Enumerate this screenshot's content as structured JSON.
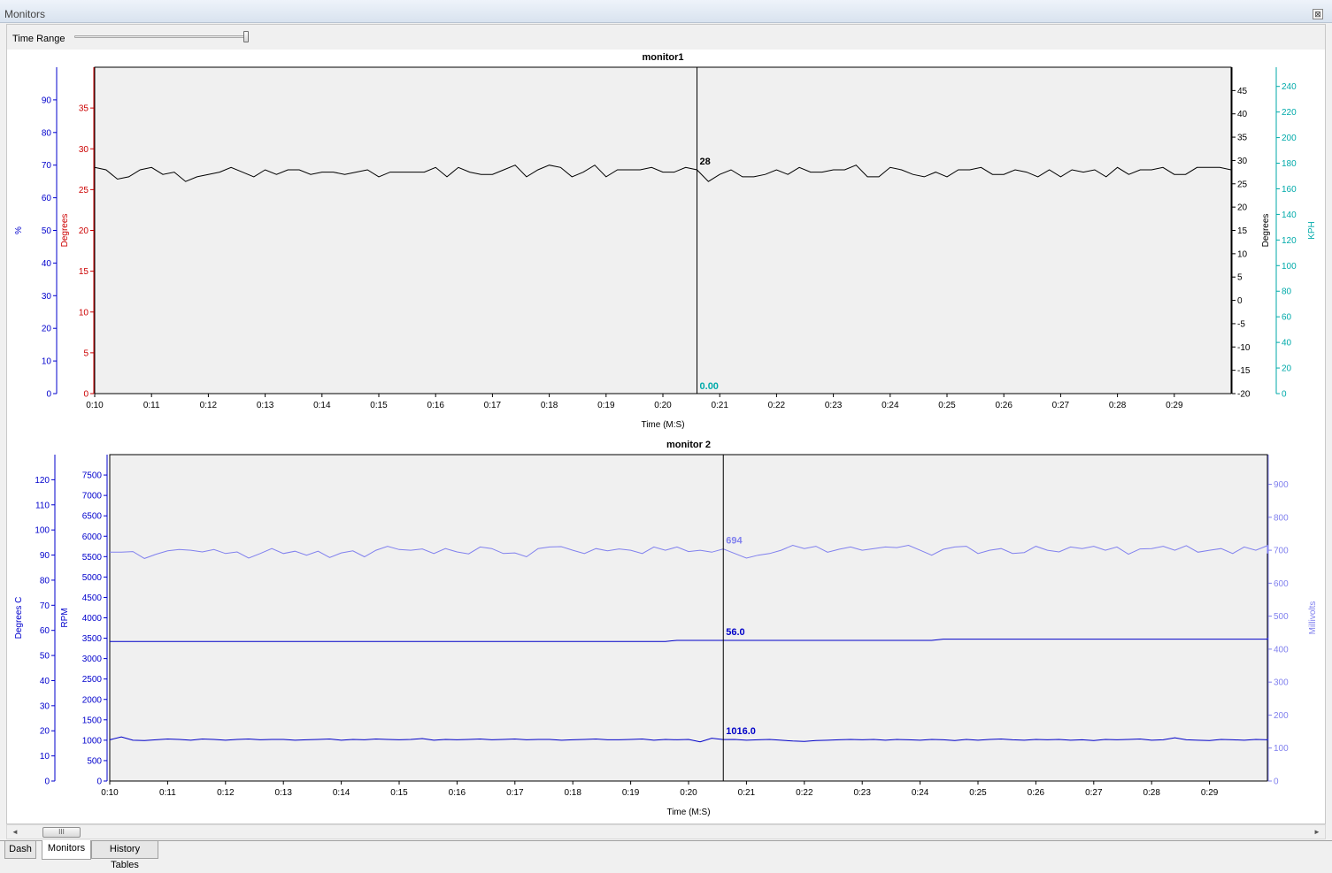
{
  "window": {
    "title": "Monitors",
    "close_glyph": "⊠"
  },
  "toolbar": {
    "time_range_label": "Time Range",
    "time_range_value": 1.0
  },
  "scrollbar": {
    "left_arrow": "◄",
    "right_arrow": "►",
    "thumb_grip": "III"
  },
  "tabs": [
    {
      "label": "Dash",
      "active": false
    },
    {
      "label": "Monitors",
      "active": true
    },
    {
      "label": "History Tables",
      "active": false
    }
  ],
  "colors": {
    "plot_bg": "#f0f0f0",
    "blue_axis": "#0000cc",
    "red_axis": "#cc0000",
    "black": "#000000",
    "cyan": "#00aaaa",
    "lavender": "#8080ee",
    "navy": "#0000c8"
  },
  "x_ticks": [
    "0:10",
    "0:11",
    "0:12",
    "0:13",
    "0:14",
    "0:15",
    "0:16",
    "0:17",
    "0:18",
    "0:19",
    "0:20",
    "0:21",
    "0:22",
    "0:23",
    "0:24",
    "0:25",
    "0:26",
    "0:27",
    "0:28",
    "0:29"
  ],
  "chart_data": [
    {
      "type": "line",
      "title": "monitor1",
      "xlabel": "Time (M:S)",
      "xlim": [
        "0:10",
        "0:30"
      ],
      "cursor": {
        "x": "0:20.6",
        "labels": [
          "28",
          "0.00"
        ]
      },
      "axes": [
        {
          "side": "left",
          "label": "%",
          "ticks": [
            0,
            10,
            20,
            30,
            40,
            50,
            60,
            70,
            80,
            90
          ],
          "range": [
            0,
            100
          ]
        },
        {
          "side": "left",
          "label": "Degrees",
          "ticks": [
            0,
            5,
            10,
            15,
            20,
            25,
            30,
            35
          ],
          "range": [
            0,
            40
          ]
        },
        {
          "side": "right",
          "label": "Degrees",
          "ticks": [
            -20,
            -15,
            -10,
            -5,
            0,
            5,
            10,
            15,
            20,
            25,
            30,
            35,
            40,
            45
          ],
          "range": [
            -20,
            50
          ]
        },
        {
          "side": "right",
          "label": "KPH",
          "ticks": [
            0,
            20,
            40,
            60,
            80,
            100,
            120,
            140,
            160,
            180,
            200,
            220,
            240
          ],
          "range": [
            0,
            255
          ]
        }
      ],
      "series": [
        {
          "axis": 2,
          "x_start": 10.0,
          "x_step": 0.2,
          "values": [
            28.5,
            28,
            26,
            26.5,
            28,
            28.5,
            27,
            27.5,
            25.5,
            26.5,
            27,
            27.5,
            28.5,
            27.5,
            26.5,
            28,
            27,
            28,
            28,
            27,
            27.5,
            27.5,
            27,
            27.5,
            28,
            26.5,
            27.5,
            27.5,
            27.5,
            27.5,
            28.5,
            26.5,
            28.5,
            27.5,
            27,
            27,
            28,
            29,
            26.5,
            28,
            29,
            28.5,
            26.5,
            27.5,
            29,
            26.5,
            28,
            28,
            28,
            28.5,
            27.5,
            27.5,
            28.5,
            28,
            25.5,
            27,
            28,
            26.5,
            26.5,
            27,
            28,
            27,
            28.5,
            27.5,
            27.5,
            28,
            28,
            29,
            26.5,
            26.5,
            28.5,
            28,
            27,
            26.5,
            27.5,
            26.5,
            28,
            28,
            28.5,
            27,
            27,
            28,
            27.5,
            26.5,
            28,
            26.5,
            28,
            27.5,
            28,
            26.5,
            28.5,
            27,
            28,
            28,
            28.5,
            27,
            27,
            28.5,
            28.5,
            28.5,
            28,
            26,
            25.5,
            27,
            25,
            27,
            25.5,
            27,
            28.5,
            28,
            27.5,
            27.5,
            27.5,
            28,
            27,
            28,
            28,
            28
          ]
        }
      ]
    },
    {
      "type": "line",
      "title": "monitor 2",
      "xlabel": "Time (M:S)",
      "xlim": [
        "0:10",
        "0:30"
      ],
      "cursor": {
        "x": "0:20.6",
        "labels": [
          "694",
          "56.0",
          "1016.0"
        ]
      },
      "axes": [
        {
          "side": "left",
          "label": "Degrees C",
          "ticks": [
            0,
            10,
            20,
            30,
            40,
            50,
            60,
            70,
            80,
            90,
            100,
            110,
            120
          ],
          "range": [
            0,
            130
          ]
        },
        {
          "side": "left",
          "label": "RPM",
          "ticks": [
            0,
            500,
            1000,
            1500,
            2000,
            2500,
            3000,
            3500,
            4000,
            4500,
            5000,
            5500,
            6000,
            6500,
            7000,
            7500
          ],
          "range": [
            0,
            8000
          ]
        },
        {
          "side": "right",
          "label": "Millivolts",
          "ticks": [
            0,
            100,
            200,
            300,
            400,
            500,
            600,
            700,
            800,
            900
          ],
          "range": [
            0,
            990
          ]
        }
      ],
      "series": [
        {
          "axis": 2,
          "x_start": 10.0,
          "x_step": 0.2,
          "values": [
            694,
            694,
            696,
            675,
            688,
            698,
            702,
            700,
            695,
            702,
            690,
            695,
            676,
            690,
            705,
            690,
            697,
            685,
            697,
            678,
            692,
            698,
            680,
            700,
            712,
            702,
            700,
            704,
            690,
            705,
            695,
            689,
            710,
            705,
            690,
            692,
            680,
            705,
            710,
            711,
            700,
            690,
            705,
            698,
            704,
            700,
            690,
            710,
            700,
            710,
            696,
            700,
            694,
            704,
            690,
            676,
            685,
            690,
            700,
            715,
            705,
            712,
            694,
            703,
            710,
            700,
            705,
            710,
            708,
            715,
            700,
            685,
            703,
            710,
            712,
            690,
            700,
            705,
            690,
            693,
            712,
            700,
            695,
            710,
            705,
            712,
            700,
            710,
            688,
            704,
            705,
            712,
            700,
            714,
            694,
            700,
            705,
            690,
            710,
            700,
            714,
            712,
            700,
            712,
            695,
            690,
            714,
            712,
            700,
            712,
            695,
            700,
            704,
            714,
            712,
            700,
            712,
            690,
            700,
            705
          ]
        },
        {
          "axis": 0,
          "x_start": 10.0,
          "x_step": 0.2,
          "values": [
            55.6,
            55.6,
            55.6,
            55.6,
            55.6,
            55.6,
            55.6,
            55.6,
            55.6,
            55.6,
            55.6,
            55.6,
            55.6,
            55.6,
            55.6,
            55.6,
            55.6,
            55.6,
            55.6,
            55.6,
            55.6,
            55.6,
            55.6,
            55.6,
            55.6,
            55.6,
            55.6,
            55.6,
            55.6,
            55.6,
            55.6,
            55.6,
            55.6,
            55.6,
            55.6,
            55.6,
            55.6,
            55.6,
            55.6,
            55.6,
            55.6,
            55.6,
            55.6,
            55.6,
            55.6,
            55.6,
            55.6,
            55.6,
            55.6,
            56.0,
            56.0,
            56.0,
            56.0,
            56.0,
            56.0,
            56.0,
            56.0,
            56.0,
            56.0,
            56.0,
            56.0,
            56.0,
            56.0,
            56.0,
            56.0,
            56.0,
            56.0,
            56.0,
            56.0,
            56.0,
            56.0,
            56.0,
            56.5,
            56.5,
            56.5,
            56.5,
            56.5,
            56.5,
            56.5,
            56.5,
            56.5,
            56.5,
            56.5,
            56.5,
            56.5,
            56.5,
            56.5,
            56.5,
            56.5,
            56.5,
            56.5,
            56.5,
            56.5,
            56.5,
            56.5,
            56.5,
            56.5,
            56.5,
            56.5,
            56.5,
            56.5,
            56.5,
            56.5,
            56.5,
            56.5,
            56.5,
            56.5,
            57.0,
            57.0,
            57.0,
            57.0,
            57.0
          ]
        },
        {
          "axis": 1,
          "x_start": 10.0,
          "x_step": 0.2,
          "values": [
            1010,
            1080,
            1000,
            990,
            1010,
            1030,
            1020,
            1000,
            1030,
            1020,
            1000,
            1020,
            1030,
            1010,
            1020,
            1020,
            1000,
            1010,
            1020,
            1030,
            1000,
            1020,
            1010,
            1030,
            1020,
            1010,
            1020,
            1040,
            1000,
            1020,
            1010,
            1020,
            1030,
            1010,
            1020,
            1030,
            1010,
            1020,
            1020,
            1000,
            1010,
            1020,
            1030,
            1010,
            1010,
            1020,
            1030,
            1000,
            1020,
            1010,
            1020,
            960,
            1050,
            1016,
            1020,
            1000,
            1010,
            1020,
            1000,
            980,
            970,
            990,
            1000,
            1010,
            1020,
            1010,
            1020,
            1000,
            1020,
            1010,
            1000,
            1020,
            1010,
            990,
            1020,
            1000,
            1020,
            1030,
            1010,
            1000,
            1020,
            1010,
            1020,
            1000,
            1010,
            990,
            1020,
            1010,
            1020,
            1030,
            1000,
            1010,
            1060,
            1010,
            1000,
            990,
            1020,
            1010,
            1000,
            1020,
            1010,
            1030,
            1020,
            1010,
            1000,
            1020,
            1030,
            1010,
            1020,
            1010,
            1000,
            1020
          ]
        }
      ]
    }
  ]
}
